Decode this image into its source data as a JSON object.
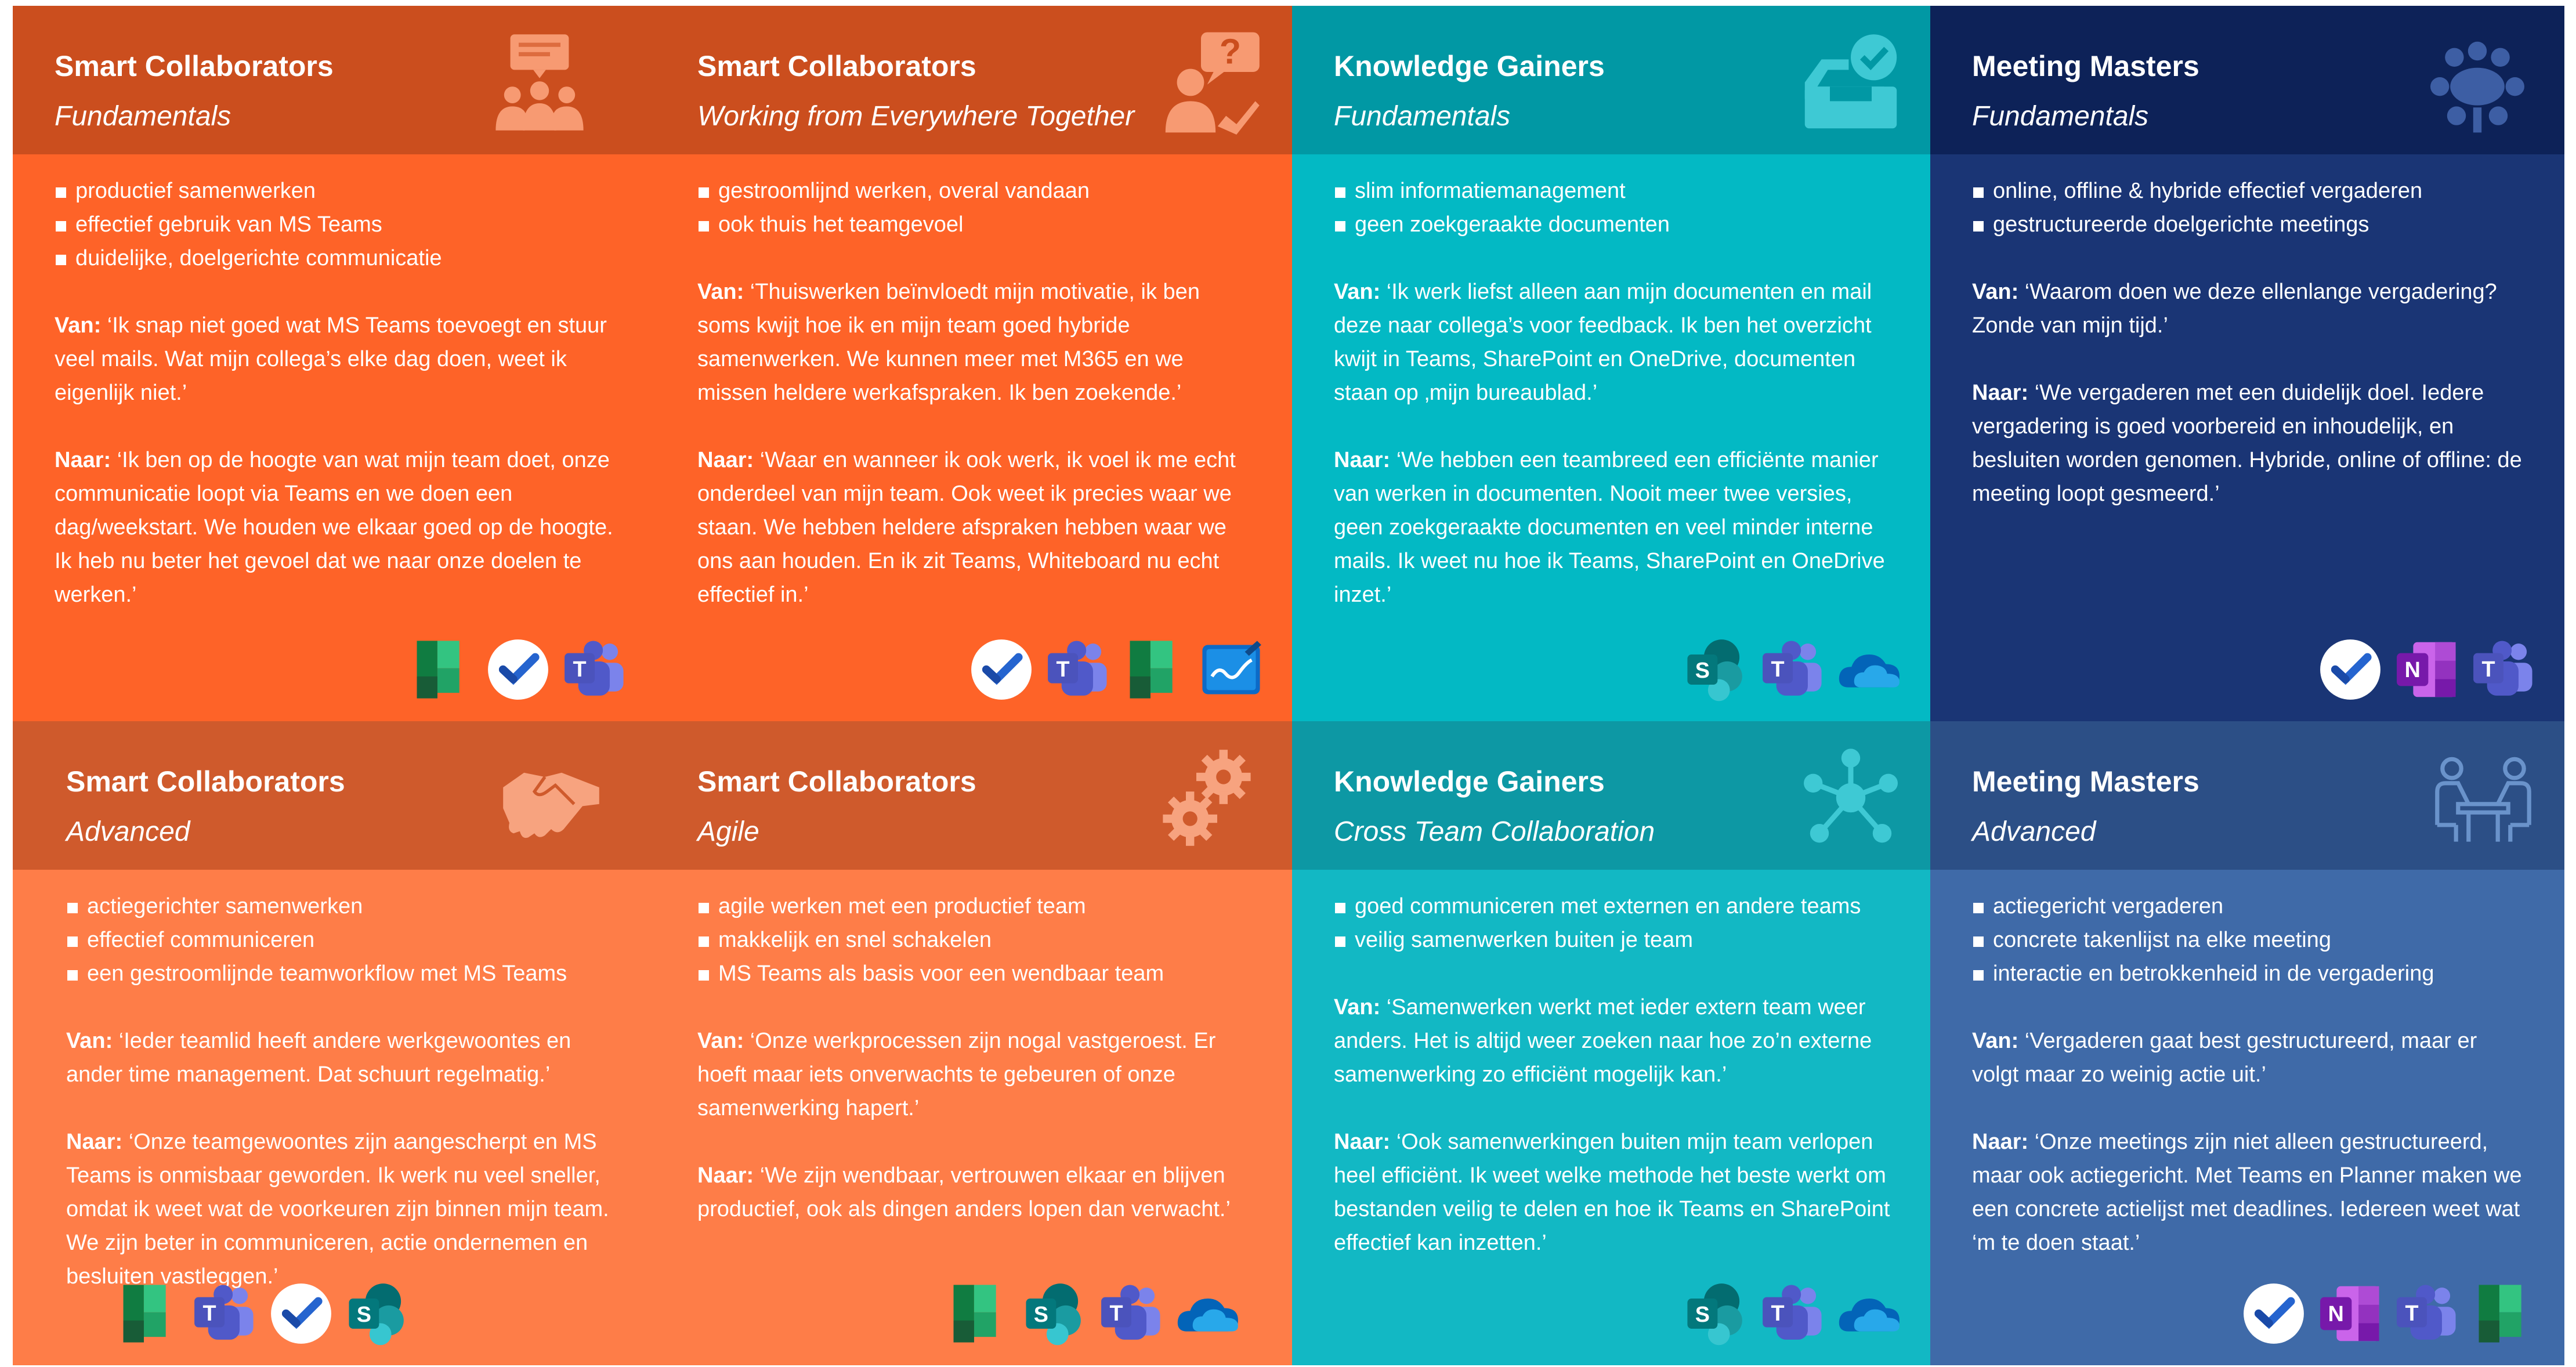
{
  "cards": [
    {
      "title": "Smart Collaborators",
      "subtitle": "Fundamentals",
      "header_icon": "presentation-audience-icon",
      "bullets": [
        "productief samenwerken",
        "effectief gebruik van MS Teams",
        "duidelijke, doelgerichte communicatie"
      ],
      "van_label": "Van:",
      "van_text": " ‘Ik snap niet goed wat MS Teams toevoegt en stuur veel mails. Wat mijn collega’s elke dag doen, weet ik eigenlijk niet.’",
      "naar_label": "Naar:",
      "naar_text": " ‘Ik ben op de hoogte van wat mijn team doet, onze communicatie loopt via Teams en we doen een dag/weekstart. We houden we elkaar goed op de hoogte. Ik heb nu beter het gevoel dat we naar onze doelen te werken.’",
      "apps": [
        "planner-icon",
        "todo-icon",
        "teams-icon"
      ],
      "colors": {
        "header": "#cb4e1e",
        "body": "#fe6328",
        "header_icon": "#f79a72"
      }
    },
    {
      "title": "Smart Collaborators",
      "subtitle": "Working from Everywhere Together",
      "header_icon": "person-question-icon",
      "bullets": [
        "gestroomlijnd werken, overal vandaan",
        "ook thuis het teamgevoel"
      ],
      "van_label": "Van:",
      "van_text": " ‘Thuiswerken beïnvloedt mijn motivatie, ik ben soms kwijt hoe ik en mijn team goed hybride samenwerken. We kunnen meer met M365 en we missen heldere werkafspraken. Ik ben zoekende.’",
      "naar_label": "Naar:",
      "naar_text": " ‘Waar en wanneer ik ook werk, ik voel ik me echt onderdeel van mijn team. Ook weet ik precies waar we staan. We hebben heldere afspraken hebben waar we ons aan houden. En ik zit Teams, Whiteboard nu echt effectief in.’",
      "apps": [
        "todo-icon",
        "teams-icon",
        "planner-icon",
        "whiteboard-icon"
      ],
      "colors": {
        "header": "#cb4e1e",
        "body": "#fe6328",
        "header_icon": "#f79a72"
      }
    },
    {
      "title": "Knowledge Gainers",
      "subtitle": "Fundamentals",
      "header_icon": "inbox-check-icon",
      "bullets": [
        "slim informatiemanagement",
        "geen zoekgeraakte documenten"
      ],
      "van_label": "Van:",
      "van_text": " ‘Ik werk liefst alleen aan mijn documenten en mail deze naar collega’s voor feedback. Ik ben het overzicht kwijt in Teams, SharePoint en OneDrive, documenten staan op ‚mijn bureaublad.’",
      "naar_label": "Naar:",
      "naar_text": " ‘We hebben een teambreed een efficiënte manier van werken in documenten. Nooit meer twee versies, geen zoekgeraakte documenten en veel minder interne mails. Ik weet nu hoe ik Teams, SharePoint en OneDrive inzet.’",
      "apps": [
        "sharepoint-icon",
        "teams-icon",
        "onedrive-icon"
      ],
      "colors": {
        "header": "#0198a4",
        "body": "#03b9c4",
        "header_icon": "#3ec9d4"
      }
    },
    {
      "title": "Meeting Masters",
      "subtitle": "Fundamentals",
      "header_icon": "meeting-table-icon",
      "bullets": [
        "online, offline & hybride effectief vergaderen",
        "gestructureerde doelgerichte meetings"
      ],
      "van_label": "Van:",
      "van_text": " ‘Waarom doen we deze ellenlange vergadering? Zonde van mijn tijd.’",
      "naar_label": "Naar:",
      "naar_text": " ‘We vergaderen met een duidelijk doel. Iedere vergadering is goed voorbereid en inhoudelijk, en besluiten worden genomen. Hybride, online of offline: de meeting loopt gesmeerd.’",
      "apps": [
        "todo-icon",
        "onenote-icon",
        "teams-icon"
      ],
      "colors": {
        "header": "#0d2258",
        "body": "#1a3575",
        "header_icon": "#3d5ea4"
      }
    },
    {
      "title": "Smart Collaborators",
      "subtitle": "Advanced",
      "header_icon": "handshake-icon",
      "bullets": [
        "actiegerichter samenwerken",
        "effectief communiceren",
        "een gestroomlijnde teamworkflow met MS Teams"
      ],
      "van_label": "Van:",
      "van_text": " ‘Ieder teamlid heeft andere werkgewoontes en ander time management. Dat schuurt regelmatig.’",
      "naar_label": "Naar:",
      "naar_text": " ‘Onze teamgewoontes zijn aangescherpt en MS Teams is onmisbaar geworden. Ik werk nu veel sneller, omdat ik weet wat de voorkeuren zijn binnen mijn team. We zijn beter in communiceren, actie ondernemen en besluiten vastleggen.’",
      "apps": [
        "planner-icon",
        "teams-icon",
        "todo-icon",
        "sharepoint-icon"
      ],
      "colors": {
        "header": "#cf5a2c",
        "body": "#fe7d48",
        "header_icon": "#f7a37f"
      }
    },
    {
      "title": "Smart Collaborators",
      "subtitle": "Agile",
      "header_icon": "gears-icon",
      "bullets": [
        "agile werken met een productief team",
        "makkelijk en snel schakelen",
        "MS Teams als basis voor een wendbaar team"
      ],
      "van_label": "Van:",
      "van_text": " ‘Onze werkprocessen zijn nogal vastgeroest. Er hoeft maar iets onverwachts te gebeuren of onze samenwerking hapert.’",
      "naar_label": "Naar:",
      "naar_text": " ‘We zijn wendbaar, vertrouwen elkaar en blijven productief, ook als dingen anders lopen dan verwacht.’",
      "apps": [
        "planner-icon",
        "sharepoint-icon",
        "teams-icon",
        "onedrive-icon"
      ],
      "colors": {
        "header": "#cf5a2c",
        "body": "#fe7d48",
        "header_icon": "#f7a37f"
      }
    },
    {
      "title": "Knowledge Gainers",
      "subtitle": "Cross Team Collaboration",
      "header_icon": "network-hub-icon",
      "bullets": [
        "goed communiceren met externen en andere teams",
        "veilig samenwerken buiten je team"
      ],
      "van_label": "Van:",
      "van_text": " ‘Samenwerken werkt met ieder extern team weer anders. Het is altijd weer zoeken naar hoe zo’n externe samenwerking zo efficiënt mogelijk kan.’",
      "naar_label": "Naar:",
      "naar_text": " ‘Ook samenwerkingen buiten mijn team verlopen heel efficiënt. Ik weet welke methode het beste werkt om bestanden veilig te delen en hoe ik Teams en SharePoint effectief kan inzetten.’",
      "apps": [
        "sharepoint-icon",
        "teams-icon",
        "onedrive-icon"
      ],
      "colors": {
        "header": "#0d98a4",
        "body": "#12b8c4",
        "header_icon": "#3ec9d4"
      }
    },
    {
      "title": "Meeting Masters",
      "subtitle": "Advanced",
      "header_icon": "meeting-desk-icon",
      "bullets": [
        "actiegericht vergaderen",
        "concrete takenlijst na elke meeting",
        "interactie en betrokkenheid in de vergadering"
      ],
      "van_label": "Van:",
      "van_text": " ‘Vergaderen gaat best gestructureerd, maar er volgt maar zo weinig actie uit.’",
      "naar_label": "Naar:",
      "naar_text": " ‘Onze meetings zijn niet alleen gestructureerd, maar ook actiegericht. Met Teams en Planner maken we een concrete actielijst met deadlines. Iedereen weet wat ‘m te doen staat.’",
      "apps": [
        "todo-icon",
        "onenote-icon",
        "teams-icon",
        "planner-icon"
      ],
      "colors": {
        "header": "#2c4f86",
        "body": "#3f6aa8",
        "header_icon": "#6a93cb"
      }
    }
  ]
}
